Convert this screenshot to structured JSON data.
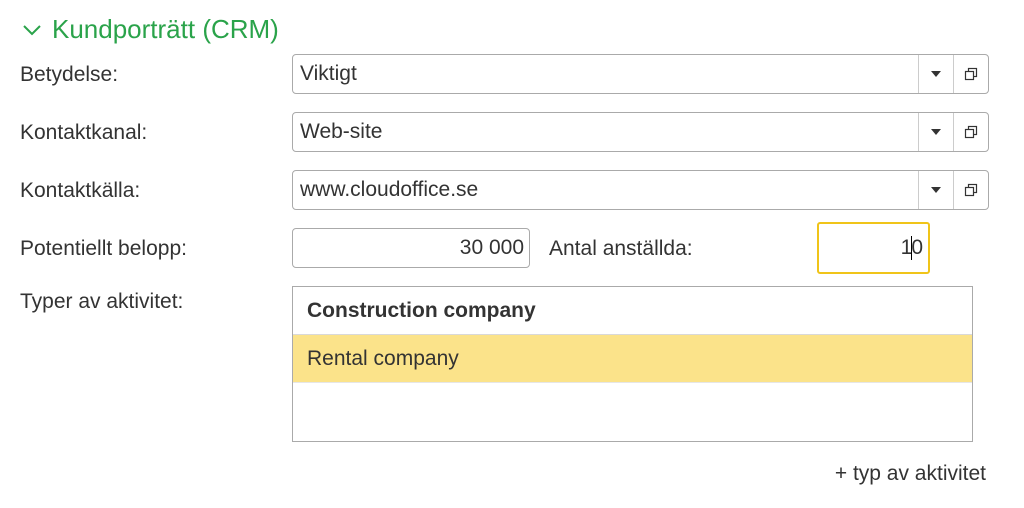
{
  "section": {
    "title": "Kundporträtt (CRM)"
  },
  "fields": {
    "betydelse": {
      "label": "Betydelse:",
      "value": "Viktigt"
    },
    "kontaktkanal": {
      "label": "Kontaktkanal:",
      "value": "Web-site"
    },
    "kontaktkalla": {
      "label": "Kontaktkälla:",
      "value": "www.cloudoffice.se"
    },
    "belopp": {
      "label": "Potentiellt belopp:",
      "value": "30 000"
    },
    "anstallda": {
      "label": "Antal anställda:",
      "value_before_caret": "1",
      "value_after_caret": "0"
    }
  },
  "activities": {
    "label": "Typer av aktivitet:",
    "header": "Construction company",
    "rows": [
      "Rental company",
      ""
    ],
    "add_label": "+ typ av aktivitet"
  },
  "colors": {
    "accent": "#2aa34a",
    "selection": "#fbe38a",
    "focus": "#f0c419"
  }
}
